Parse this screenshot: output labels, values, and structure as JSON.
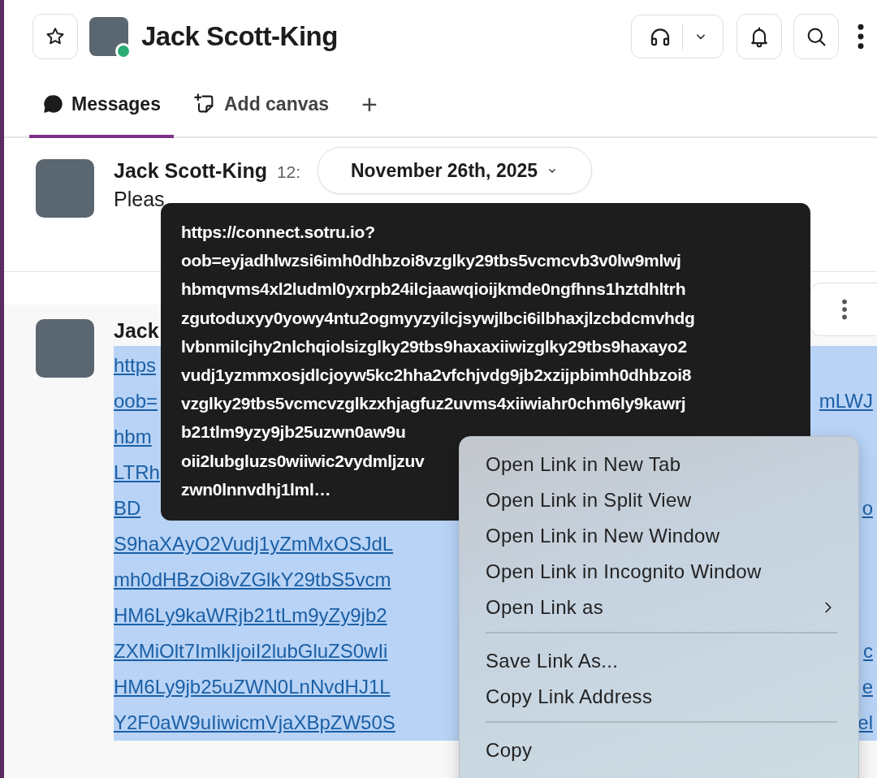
{
  "header": {
    "title": "Jack Scott-King",
    "online": true
  },
  "tabs": [
    {
      "label": "Messages",
      "selected": true,
      "kind": "messages"
    },
    {
      "label": "Add canvas",
      "selected": false,
      "kind": "canvas"
    },
    {
      "label": "+",
      "selected": false,
      "kind": "add"
    }
  ],
  "date_divider": {
    "label": "November 26th, 2025"
  },
  "messages": [
    {
      "author": "Jack Scott-King",
      "time": "12:",
      "text": "Pleas"
    },
    {
      "author": "Jack",
      "link_lines": [
        {
          "left": "https"
        },
        {
          "left": "oob=",
          "right": "mLWJ"
        },
        {
          "left": "hbm"
        },
        {
          "left": "LTRh"
        },
        {
          "left": "BD",
          "right": "o"
        },
        {
          "left": "S9haXAyO2Vudj1yZmMxOSJdL"
        },
        {
          "left": "mh0dHBzOi8vZGlkY29tbS5vcm"
        },
        {
          "left": "HM6Ly9kaWRjb21tLm9yZy9jb2"
        },
        {
          "left": "ZXMiOlt7ImlkIjoiI2lubGluZS0wIi",
          "right": "c"
        },
        {
          "left": "HM6Ly9jb25uZWN0LnNvdHJ1L",
          "right": "e"
        },
        {
          "left": "Y2F0aW9uIiwicmVjaXBpZW50S",
          "right": "el"
        }
      ]
    }
  ],
  "tooltip": {
    "lines": [
      "https://connect.sotru.io?",
      "oob=eyjadhlwzsi6imh0dhbzoi8vzglky29tbs5vcmcvb3v0lw9mlwj",
      "hbmqvms4xl2ludml0yxrpb24ilcjaawqioijkmde0ngfhns1hztdhltrh",
      "zgutoduxyy0yowy4ntu2ogmyyzyilcjsywjlbci6ilbhaxjlzcbdcmvhdg",
      "lvbnmilcjhy2nlchqiolsizglky29tbs9haxaxiiwizglky29tbs9haxayo2",
      "vudj1yzmmxosjdlcjoyw5kc2hha2vfchjvdg9jb2xzijpbimh0dhbzoi8",
      "vzglky29tbs5vcmcvzglkzxhjagfuz2uvms4xiiwiahr0chm6ly9kawrj",
      "b21tlm9yzy9jb25uzwn0aw9u",
      "oii2lubgluzs0wiiwic2vydmljzuv",
      "zwn0lnnvdhj1lml…"
    ]
  },
  "context_menu": {
    "items": [
      {
        "label": "Open Link in New Tab",
        "kind": "item"
      },
      {
        "label": "Open Link in Split View",
        "kind": "item"
      },
      {
        "label": "Open Link in New Window",
        "kind": "item"
      },
      {
        "label": "Open Link in Incognito Window",
        "kind": "item"
      },
      {
        "label": "Open Link as",
        "kind": "submenu"
      },
      {
        "kind": "separator"
      },
      {
        "label": "Save Link As...",
        "kind": "item"
      },
      {
        "label": "Copy Link Address",
        "kind": "item"
      },
      {
        "kind": "separator"
      },
      {
        "label": "Copy",
        "kind": "item"
      }
    ]
  }
}
